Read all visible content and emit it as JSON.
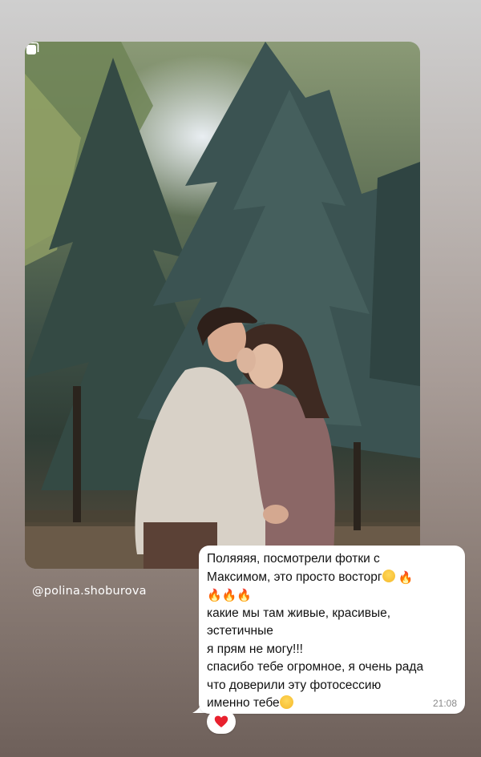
{
  "story": {
    "mention": "@polina.shoburova",
    "photo_icon": "expand-square-icon"
  },
  "message": {
    "lines": [
      "Поляяяя, посмотрели фотки с",
      "Максимом, это просто восторг",
      "",
      "какие мы там живые, красивые,",
      "эстетичные",
      "я прям не могу!!!",
      "спасибо тебе огромное, я очень рада",
      "что доверили эту фотосессию",
      "именно тебе"
    ],
    "time": "21:08",
    "emojis": {
      "line2": [
        "pleading-face",
        "fire"
      ],
      "line3": [
        "fire",
        "fire",
        "fire"
      ],
      "line9": [
        "smiling-face-with-heart-eyes"
      ]
    },
    "reaction": "red-heart",
    "colors": {
      "bubble": "#ffffff",
      "text": "#111111",
      "time": "#8a8a8a",
      "heart": "#e8212e",
      "fire": "#f2601b"
    }
  }
}
